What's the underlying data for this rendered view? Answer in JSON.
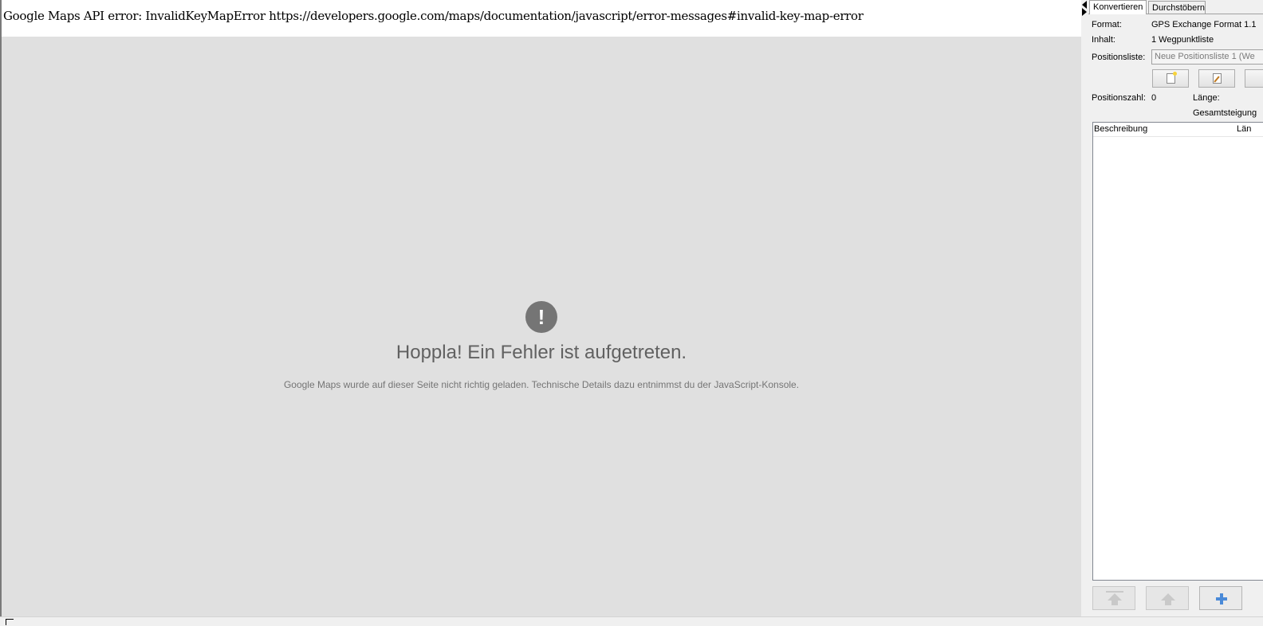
{
  "map": {
    "api_error": "Google Maps API error: InvalidKeyMapError https://developers.google.com/maps/documentation/javascript/error-messages#invalid-key-map-error",
    "error_icon_glyph": "!",
    "error_title": "Hoppla! Ein Fehler ist aufgetreten.",
    "error_message": "Google Maps wurde auf dieser Seite nicht richtig geladen. Technische Details dazu entnimmst du der JavaScript-Konsole.",
    "panel_color": "#e0e0e0"
  },
  "side_panel": {
    "tabs": [
      {
        "label": "Konvertieren",
        "selected": true
      },
      {
        "label": "Durchstöbern",
        "selected": false
      }
    ],
    "format_label": "Format:",
    "format_value": "GPS Exchange Format 1.1",
    "content_label": "Inhalt:",
    "content_value": "1 Wegpunktliste",
    "positionlist_label": "Positionsliste:",
    "positionlist_value": "Neue Positionsliste 1 (We",
    "position_count_label": "Positionszahl:",
    "position_count_value": "0",
    "length_label": "Länge:",
    "total_ascent_label": "Gesamtsteigung",
    "table": {
      "columns": [
        "Beschreibung",
        "Län"
      ],
      "rows": []
    },
    "icons": {
      "new_list": "new-document-icon",
      "edit_list": "edit-document-icon",
      "move_top": "move-to-top-icon",
      "move_up": "move-up-icon",
      "add": "plus-icon"
    }
  }
}
